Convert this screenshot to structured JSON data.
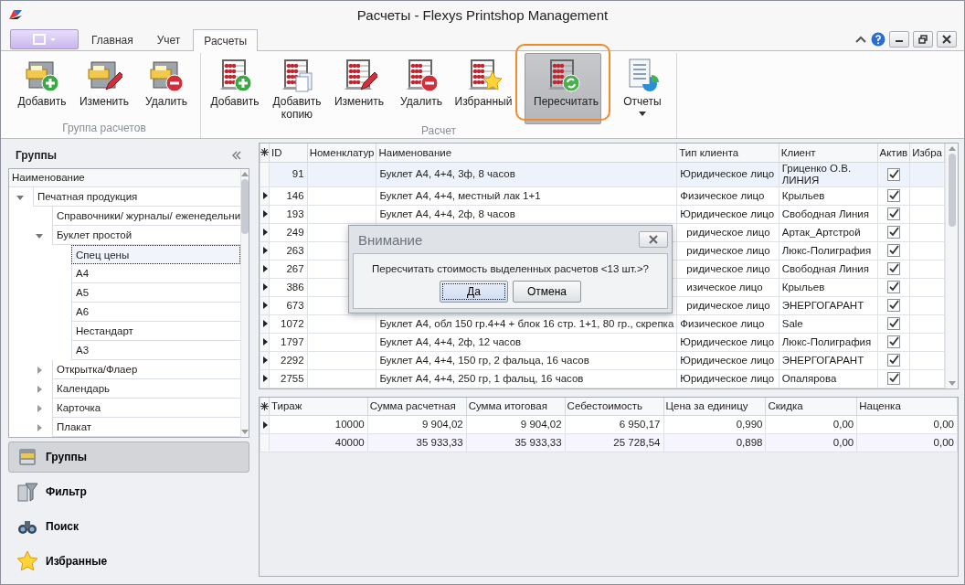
{
  "window": {
    "title": "Расчеты - Flexys Printshop Management"
  },
  "tabs": [
    {
      "label": "Главная",
      "selected": false
    },
    {
      "label": "Учет",
      "selected": false
    },
    {
      "label": "Расчеты",
      "selected": true
    }
  ],
  "ribbon": {
    "groups": [
      {
        "title": "Группа расчетов",
        "buttons": [
          {
            "label": "Добавить",
            "kind": "add",
            "selected": false
          },
          {
            "label": "Изменить",
            "kind": "edit",
            "selected": false
          },
          {
            "label": "Удалить",
            "kind": "delete",
            "selected": false
          }
        ]
      },
      {
        "title": "Расчет",
        "buttons": [
          {
            "label": "Добавить",
            "kind": "add",
            "selected": false
          },
          {
            "label": "Добавить копию",
            "kind": "copy",
            "selected": false
          },
          {
            "label": "Изменить",
            "kind": "edit",
            "selected": false
          },
          {
            "label": "Удалить",
            "kind": "delete",
            "selected": false
          },
          {
            "label": "Избранный",
            "kind": "favorite",
            "selected": false
          },
          {
            "label": "Пересчитать",
            "kind": "recalc",
            "selected": true,
            "highlighted": true
          },
          {
            "label": "Отчеты",
            "kind": "reports",
            "selected": false,
            "dropdown": true
          }
        ]
      }
    ]
  },
  "sidebar": {
    "title": "Группы",
    "tree": {
      "header": "Наименование",
      "items": [
        {
          "label": "Печатная продукция",
          "selected": false,
          "expanded": true,
          "children": [
            {
              "label": "Справочники/ журналы/ еженедельни",
              "selected": false
            },
            {
              "label": "Буклет простой",
              "selected": false,
              "expanded": true,
              "children": [
                {
                  "label": "Спец цены",
                  "selected": true
                },
                {
                  "label": "А4",
                  "selected": false
                },
                {
                  "label": "А5",
                  "selected": false
                },
                {
                  "label": "А6",
                  "selected": false
                },
                {
                  "label": "Нестандарт",
                  "selected": false
                },
                {
                  "label": "А3",
                  "selected": false
                }
              ]
            },
            {
              "label": "Открытка/Флаер",
              "selected": false,
              "expanded": false
            },
            {
              "label": "Календарь",
              "selected": false,
              "expanded": false
            },
            {
              "label": "Карточка",
              "selected": false,
              "expanded": false
            },
            {
              "label": "Плакат",
              "selected": false,
              "expanded": false
            }
          ]
        }
      ]
    },
    "nav": [
      {
        "label": "Группы",
        "kind": "groups",
        "selected": true
      },
      {
        "label": "Фильтр",
        "kind": "filter",
        "selected": false
      },
      {
        "label": "Поиск",
        "kind": "search",
        "selected": false
      },
      {
        "label": "Избранные",
        "kind": "favorites",
        "selected": false
      }
    ]
  },
  "grid": {
    "columns": [
      "ID",
      "Номенклатур",
      "Наименование",
      "Тип клиента",
      "Клиент",
      "Актив",
      "Избра"
    ],
    "rows": [
      {
        "id": "91",
        "name": "Буклет А4, 4+4,  3ф, 8 часов",
        "client_type": "Юридическое лицо",
        "client": "Гриценко О.В. ЛИНИЯ",
        "active": true,
        "arrow": false,
        "selected": true
      },
      {
        "id": "146",
        "name": "Буклет А4, 4+4, местный лак 1+1",
        "client_type": "Физическое лицо",
        "client": "Крыльев",
        "active": true,
        "arrow": true,
        "selected": false
      },
      {
        "id": "193",
        "name": "Буклет А4, 4+4,  2ф, 8 часов",
        "client_type": "Юридическое лицо",
        "client": "Свободная Линия",
        "active": true,
        "arrow": true,
        "selected": false
      },
      {
        "id": "249",
        "client_type": "ридическое лицо",
        "client": "Артак_Артстрой",
        "active": true,
        "arrow": true,
        "selected": false
      },
      {
        "id": "263",
        "client_type": "ридическое лицо",
        "client": "Люкс-Полиграфия",
        "active": true,
        "arrow": true,
        "selected": false
      },
      {
        "id": "267",
        "client_type": "ридическое лицо",
        "client": "Свободная Линия",
        "active": true,
        "arrow": true,
        "selected": false
      },
      {
        "id": "386",
        "client_type": "изическое лицо",
        "client": "Крыльев",
        "active": true,
        "arrow": true,
        "selected": false
      },
      {
        "id": "673",
        "client_type": "ридическое лицо",
        "client": "ЭНЕРГОГАРАНТ",
        "active": true,
        "arrow": true,
        "selected": false
      },
      {
        "id": "1072",
        "name": "Буклет А4, обл 150 гр.4+4 + блок 16 стр. 1+1, 80 гр., скрепка",
        "client_type": "Физическое лицо",
        "client": "Sale",
        "active": true,
        "arrow": true,
        "selected": false
      },
      {
        "id": "1797",
        "name": "Буклет А4, 4+4,  2ф, 12 часов",
        "client_type": "Юридическое лицо",
        "client": "Люкс-Полиграфия",
        "active": true,
        "arrow": true,
        "selected": false
      },
      {
        "id": "2292",
        "name": "Буклет А4, 4+4, 150 гр, 2 фальца, 16 часов",
        "client_type": "Юридическое лицо",
        "client": "ЭНЕРГОГАРАНТ",
        "active": true,
        "arrow": true,
        "selected": false
      },
      {
        "id": "2755",
        "name": "Буклет А4, 4+4, 250 гр, 1 фальц, 16 часов",
        "client_type": "Юридическое лицо",
        "client": "Опалярова",
        "active": true,
        "arrow": true,
        "selected": false
      }
    ]
  },
  "dialog": {
    "title": "Внимание",
    "message": "Пересчитать стоимость выделенных расчетов <13 шт.>?",
    "buttons": [
      {
        "label": "Да",
        "selected": true
      },
      {
        "label": "Отмена",
        "selected": false
      }
    ]
  },
  "prices": {
    "columns": [
      "Тираж",
      "Сумма расчетная",
      "Сумма итоговая",
      "Себестоимость",
      "Цена за единицу",
      "Скидка",
      "Наценка"
    ],
    "rows": [
      {
        "arrow": true,
        "cells": [
          "10000",
          "9 904,02",
          "9 904,02",
          "6 950,17",
          "0,990",
          "0,00",
          "0,00"
        ]
      },
      {
        "arrow": false,
        "cells": [
          "40000",
          "35 933,33",
          "35 933,33",
          "25 728,54",
          "0,898",
          "0,00",
          "0,00"
        ]
      }
    ]
  }
}
